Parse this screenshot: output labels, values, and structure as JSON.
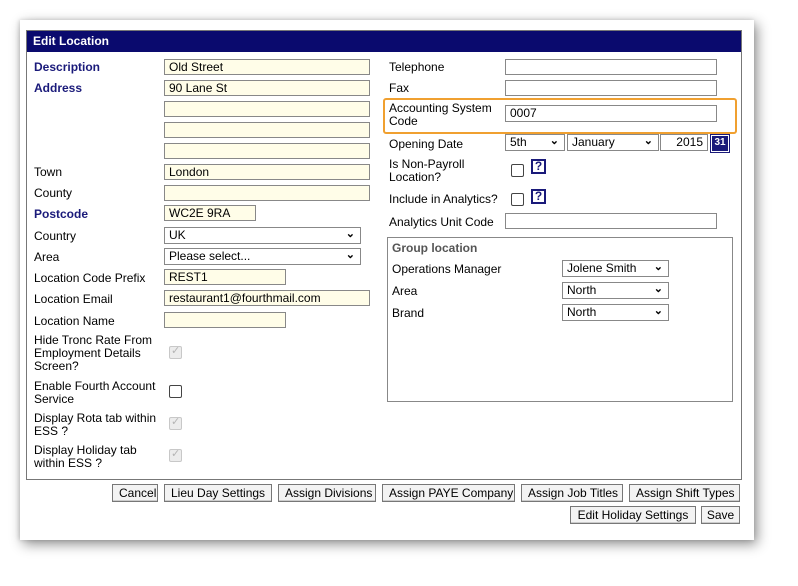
{
  "title": "Edit Location",
  "left": {
    "description": {
      "label": "Description",
      "value": "Old Street"
    },
    "address": {
      "label": "Address",
      "line1": "90 Lane St",
      "line2": "",
      "line3": "",
      "line4": ""
    },
    "town": {
      "label": "Town",
      "value": "London"
    },
    "county": {
      "label": "County",
      "value": ""
    },
    "postcode": {
      "label": "Postcode",
      "value": "WC2E 9RA"
    },
    "country": {
      "label": "Country",
      "value": "UK"
    },
    "area": {
      "label": "Area",
      "value": "Please select..."
    },
    "location_code_prefix": {
      "label": "Location Code Prefix",
      "value": "REST1"
    },
    "location_email": {
      "label": "Location Email",
      "value": "restaurant1@fourthmail.com"
    },
    "location_name": {
      "label": "Location Name",
      "value": ""
    },
    "hide_tronc": {
      "label_l1": "Hide Tronc Rate From",
      "label_l2": "Employment Details",
      "label_l3": "Screen?"
    },
    "enable_fourth": {
      "label_l1": "Enable Fourth Account",
      "label_l2": "Service"
    },
    "display_rota": {
      "label_l1": "Display Rota tab within",
      "label_l2": "ESS ?"
    },
    "display_holiday": {
      "label_l1": "Display Holiday tab",
      "label_l2": "within ESS ?"
    }
  },
  "right": {
    "telephone": {
      "label": "Telephone",
      "value": ""
    },
    "fax": {
      "label": "Fax",
      "value": ""
    },
    "accounting": {
      "label_l1": "Accounting System",
      "label_l2": "Code",
      "value": "0007"
    },
    "opening_date": {
      "label": "Opening Date",
      "day": "5th",
      "month": "January",
      "year": "2015",
      "cal_icon": "31"
    },
    "non_payroll": {
      "label_l1": "Is Non-Payroll",
      "label_l2": "Location?"
    },
    "analytics": {
      "label": "Include in Analytics?"
    },
    "analytics_unit": {
      "label": "Analytics Unit Code",
      "value": ""
    },
    "help_glyph": "?",
    "group": {
      "legend": "Group location",
      "ops_manager": {
        "label": "Operations Manager",
        "value": "Jolene Smith"
      },
      "area": {
        "label": "Area",
        "value": "North"
      },
      "brand": {
        "label": "Brand",
        "value": "North"
      }
    }
  },
  "buttons": {
    "cancel": "Cancel",
    "lieu": "Lieu Day Settings",
    "divisions": "Assign Divisions",
    "paye": "Assign PAYE Company",
    "job_titles": "Assign Job Titles",
    "shift_types": "Assign Shift Types",
    "holiday": "Edit Holiday Settings",
    "save": "Save"
  },
  "colors": {
    "title_bar": "#0a0a6e",
    "label_accent": "#1a1a7a",
    "highlight": "#f0a030",
    "input_bg": "#fffde8"
  },
  "icons": {
    "select_arrow": "chevron-down-icon",
    "calendar": "calendar-icon",
    "help": "help-icon"
  }
}
